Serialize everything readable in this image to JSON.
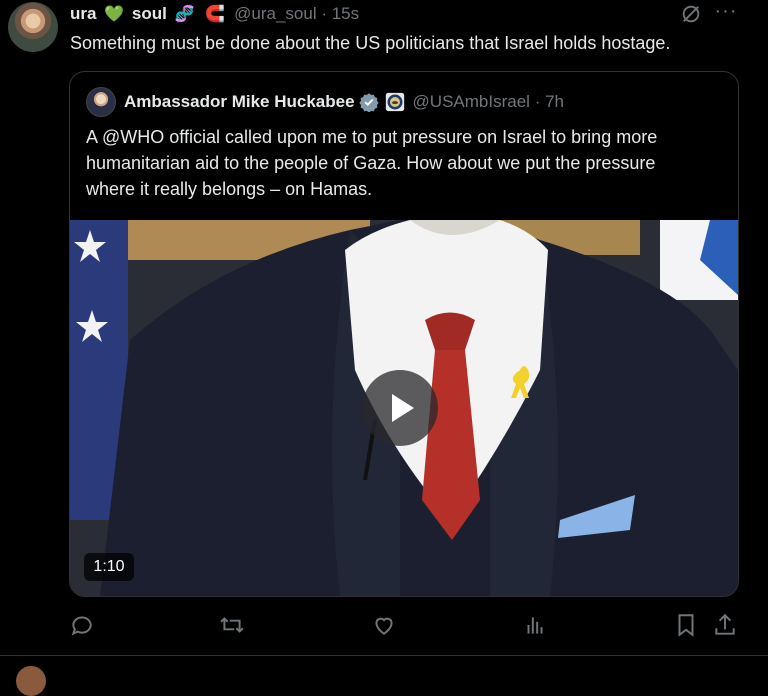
{
  "post": {
    "display_name_part1": "ura",
    "display_name_part2": "soul",
    "emoji_heart": "💚",
    "emoji_dna": "🧬",
    "emoji_magnet": "🧲",
    "handle": "@ura_soul",
    "time": "15s",
    "text": "Something must be done about the US politicians that Israel holds hostage."
  },
  "quote": {
    "name": "Ambassador Mike Huckabee",
    "handle": "@USAmbIsrael",
    "time": "7h",
    "text_lines": [
      "A @WHO official called upon me to put pressure on Israel to bring more",
      "humanitarian aid to the people of Gaza. How about we put the pressure",
      "where it really belongs – on Hamas."
    ],
    "video_duration": "1:10"
  },
  "icons": [
    "grok-icon",
    "more-icon",
    "reply-icon",
    "repost-icon",
    "like-icon",
    "views-icon",
    "bookmark-icon",
    "share-icon",
    "play-icon",
    "verified-badge-icon",
    "state-seal-icon"
  ],
  "colors": {
    "background": "#000000",
    "text": "#e7e9ea",
    "muted": "#71767b",
    "border": "#2f3336",
    "verified": "#829aab"
  }
}
